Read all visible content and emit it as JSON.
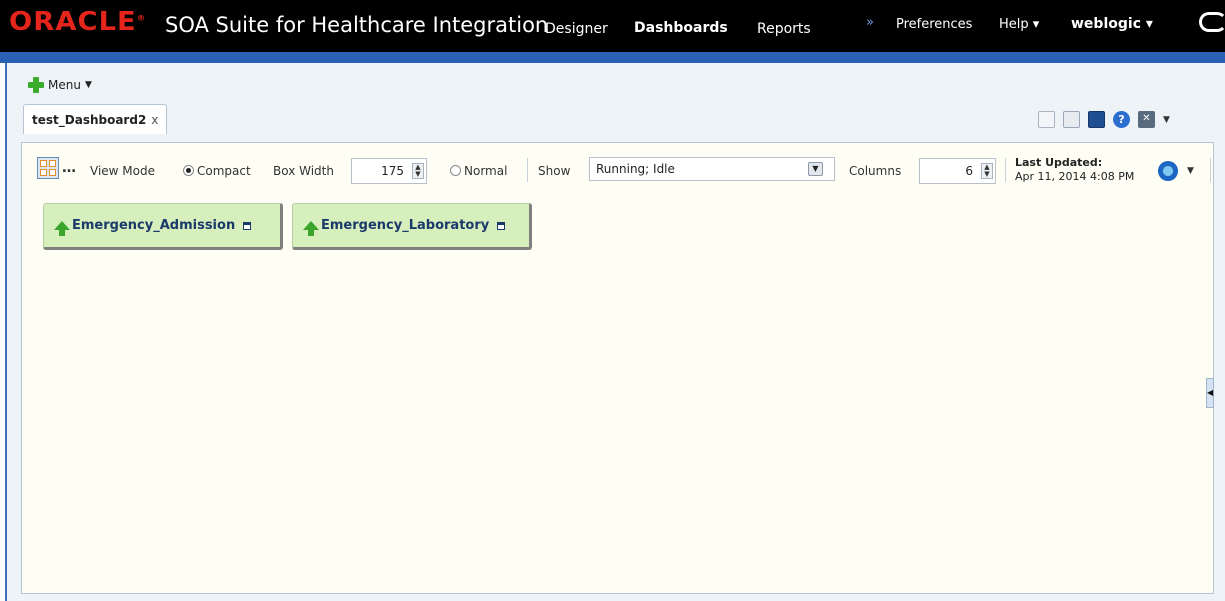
{
  "header": {
    "logo": "ORACLE",
    "logo_mark": "®",
    "title": "SOA Suite for Healthcare Integration",
    "nav": {
      "designer": "Designer",
      "dashboards": "Dashboards",
      "reports": "Reports",
      "more": "»",
      "preferences": "Preferences",
      "help": "Help ▾",
      "user": "weblogic ▾"
    }
  },
  "menu": {
    "label": "Menu"
  },
  "tab": {
    "label": "test_Dashboard2",
    "close": "x"
  },
  "toolbar": {
    "help_glyph": "?",
    "close_glyph": "✕"
  },
  "controls": {
    "dots": "…",
    "view_mode_label": "View Mode",
    "compact_label": "Compact",
    "compact_selected": true,
    "box_width_label": "Box Width",
    "box_width_value": "175",
    "normal_label": "Normal",
    "show_label": "Show",
    "show_value": "Running; Idle",
    "columns_label": "Columns",
    "columns_value": "6",
    "last_updated_label": "Last Updated:",
    "last_updated_value": "Apr 11, 2014 4:08 PM"
  },
  "components": [
    {
      "name": "Emergency_Admission",
      "status": "up"
    },
    {
      "name": "Emergency_Laboratory",
      "status": "up"
    }
  ],
  "colors": {
    "brand_red": "#e5241b",
    "header_bg": "#000000",
    "header_blue": "#2a61b4",
    "box_green": "#d6efbd",
    "status_up": "#39a62b"
  }
}
